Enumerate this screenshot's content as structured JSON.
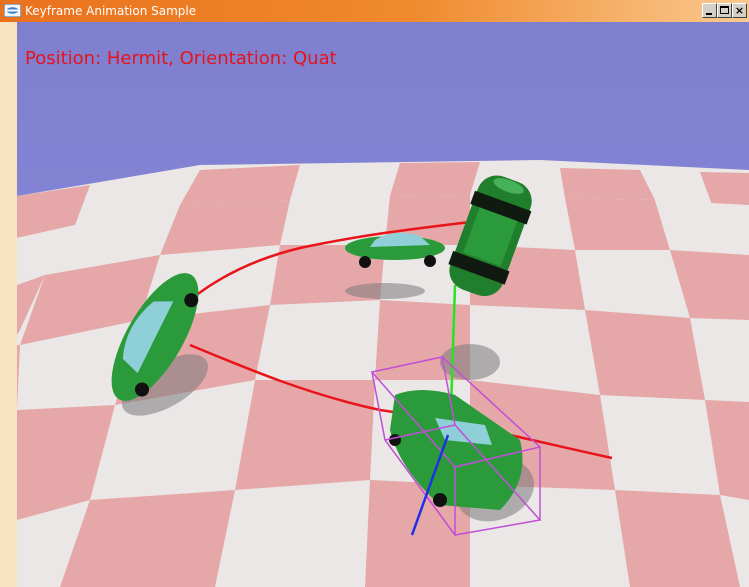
{
  "window": {
    "title": "Keyframe Animation Sample",
    "controls": {
      "minimize": "_",
      "maximize": "□",
      "close": "×"
    }
  },
  "viewport": {
    "overlay_text": "Position: Hermit, Orientation: Quat"
  },
  "colors": {
    "sky": "#7f7fd0",
    "floor_light": "#ebe7e7",
    "floor_pink": "#e6a7a8",
    "car_green": "#2a9a3a",
    "path_red": "#e8141a",
    "axis_green": "#24e424",
    "axis_blue": "#1e2fe6",
    "bbox_magenta": "#c14fd6",
    "text_red": "#e8121a"
  }
}
